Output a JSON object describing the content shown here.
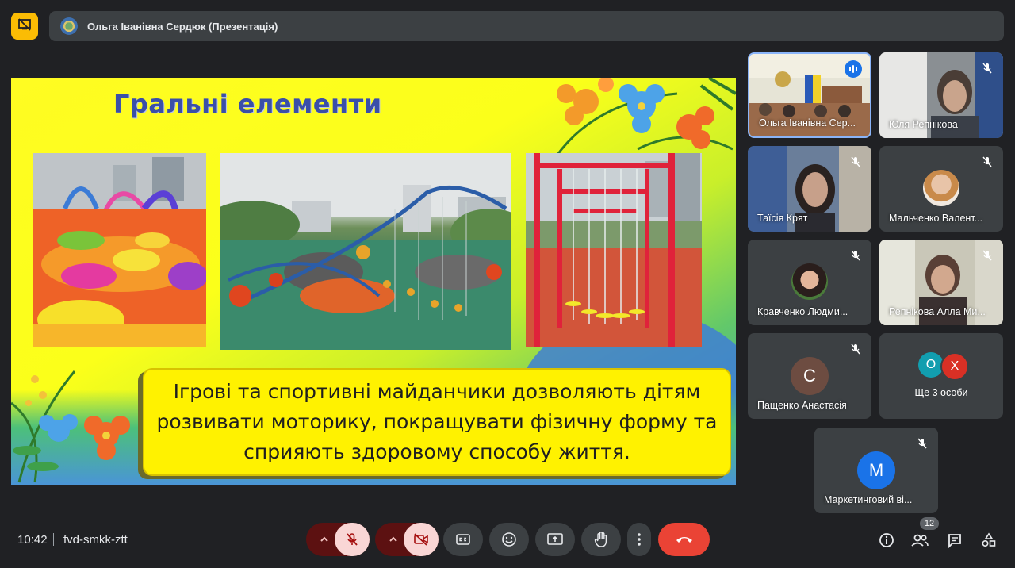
{
  "header": {
    "presenter_title": "Ольга Іванівна Сердюк (Презентація)",
    "present_icon": "present-screen-off-icon"
  },
  "slide": {
    "title": "Гральні  елементи",
    "body_lines": [
      "Ігрові та спортивні майданчики дозволяють дітям",
      "розвивати моторику, покращувати фізичну форму та",
      "сприяють здоровому способу життя."
    ]
  },
  "participants": [
    {
      "name": "Ольга Іванівна Сер...",
      "state": "speaking"
    },
    {
      "name": "Юля Репнікова",
      "state": "muted"
    },
    {
      "name": "Таїсія Крят",
      "state": "muted"
    },
    {
      "name": "Мальченко Валент...",
      "state": "muted"
    },
    {
      "name": "Кравченко Людми...",
      "state": "muted"
    },
    {
      "name": "Репнікова Алла Ми...",
      "state": "muted"
    },
    {
      "name": "Пащенко Анастасія",
      "initial": "С",
      "color": "#6d4c41",
      "state": "muted"
    },
    {
      "name": "Ще 3 особи",
      "initials": [
        "О",
        "Х"
      ],
      "colors": [
        "#129eaf",
        "#d93025"
      ]
    },
    {
      "name": "Маркетинговий ві...",
      "initial": "М",
      "color": "#1a73e8",
      "state": "muted"
    }
  ],
  "footer": {
    "time": "10:42",
    "meeting_code": "fvd-smkk-ztt",
    "participant_count": "12"
  },
  "colors": {
    "accent_yellow": "#fbbc04",
    "end_call_red": "#ea4335",
    "muted_red_bg": "#f9d6d5"
  }
}
